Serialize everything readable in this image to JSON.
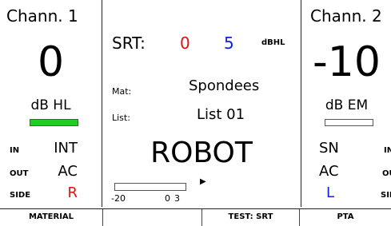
{
  "channel1": {
    "title": "Chann. 1",
    "value": "0",
    "unit": "dB HL",
    "level_bar_color": "#22cc22",
    "in_label": "IN",
    "in_value": "INT",
    "out_label": "OUT",
    "out_value": "AC",
    "side_label": "SIDE",
    "side_value": "R",
    "side_color": "#e01010"
  },
  "center": {
    "srt_label": "SRT:",
    "srt_value1": "0",
    "srt_value1_color": "#e01010",
    "srt_value2": "5",
    "srt_value2_color": "#1020e0",
    "srt_unit": "dBHL",
    "mat_label": "Mat:",
    "mat_value": "Spondees",
    "list_label": "List:",
    "list_value": "List 01",
    "word": "ROBOT",
    "meter_min": "-20",
    "meter_zero": "0",
    "meter_max": "3"
  },
  "channel2": {
    "title": "Chann. 2",
    "value": "-10",
    "unit": "dB EM",
    "in_label": "IN",
    "in_value": "SN",
    "out_label": "OUT",
    "out_value": "AC",
    "side_label": "SIDE",
    "side_value": "L",
    "side_color": "#1020e0"
  },
  "softkeys": {
    "key1": "MATERIAL",
    "key2": "",
    "key3": "TEST: SRT",
    "key4": "PTA"
  }
}
